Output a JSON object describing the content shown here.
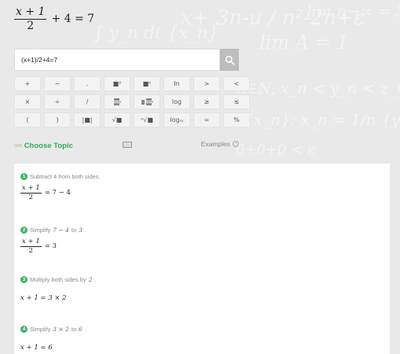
{
  "header": {
    "lhs_numerator": "x + 1",
    "lhs_denominator": "2",
    "rest": "+ 4 = 7"
  },
  "search": {
    "value": "(x+1)/2+4=7",
    "button_icon": "search-icon"
  },
  "keypad": {
    "keys": [
      "+",
      "−",
      ".",
      "■²",
      "■ⁿ",
      "ln",
      ">",
      "<",
      "×",
      "÷",
      "/",
      "fraction",
      "mixed-fraction",
      "log",
      "≥",
      "≤",
      "(",
      ")",
      "|■|",
      "√■",
      "ⁿ√■",
      "logₘ",
      "=",
      "%"
    ]
  },
  "topic": {
    "choose_label": "Choose Topic",
    "examples_label": "Examples",
    "choose_icon": "dots-icon",
    "keyboard_icon": "keyboard-icon",
    "info_icon": "info-icon"
  },
  "steps": [
    {
      "n": "1",
      "text": "Subtract 4 from both sides.",
      "eq_num": "x + 1",
      "eq_den": "2",
      "eq_rest": "= 7 − 4"
    },
    {
      "n": "2",
      "text_before": "Simplify",
      "math_a": "7 − 4",
      "text_mid": "to",
      "math_b": "3",
      "text_after": ".",
      "eq_num": "x + 1",
      "eq_den": "2",
      "eq_rest": "= 3"
    },
    {
      "n": "3",
      "text": "Multiply both sides by",
      "math_a": "2",
      "text_after": ".",
      "eq": "x + 1 = 3 × 2"
    },
    {
      "n": "4",
      "text_before": "Simplify",
      "math_a": "3 × 2",
      "text_mid": "to",
      "math_b": "6",
      "text_after": ".",
      "eq": "x + 1 = 6"
    }
  ],
  "colors": {
    "accent_green": "#2fae5f",
    "step_badge": "#3ab56a",
    "search_button": "#bdbdbd",
    "background": "#e9e9e9"
  }
}
